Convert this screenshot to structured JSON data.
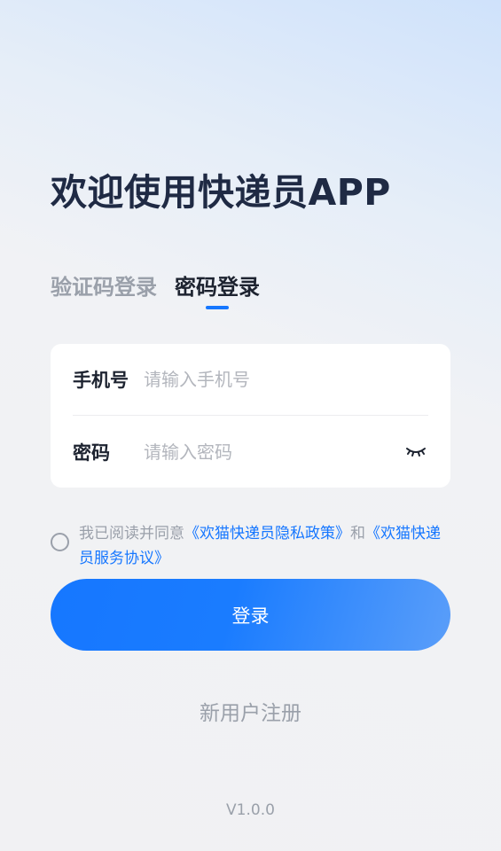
{
  "header": {
    "title": "欢迎使用快递员APP"
  },
  "tabs": [
    {
      "label": "验证码登录",
      "active": false
    },
    {
      "label": "密码登录",
      "active": true
    }
  ],
  "form": {
    "phone": {
      "label": "手机号",
      "value": "",
      "placeholder": "请输入手机号"
    },
    "password": {
      "label": "密码",
      "value": "",
      "placeholder": "请输入密码",
      "toggle_icon": "eye-closed-icon"
    }
  },
  "agreement": {
    "checked": false,
    "prefix": "我已阅读并同意",
    "privacy_link": "《欢猫快递员隐私政策》",
    "conjunction": "和",
    "service_link": "《欢猫快递员服务协议》"
  },
  "login_button": {
    "label": "登录"
  },
  "register": {
    "label": "新用户注册"
  },
  "footer": {
    "version": "V1.0.0"
  },
  "colors": {
    "accent": "#1677ff",
    "title": "#1f2a44",
    "muted": "#9aa0aa",
    "card": "#ffffff"
  }
}
